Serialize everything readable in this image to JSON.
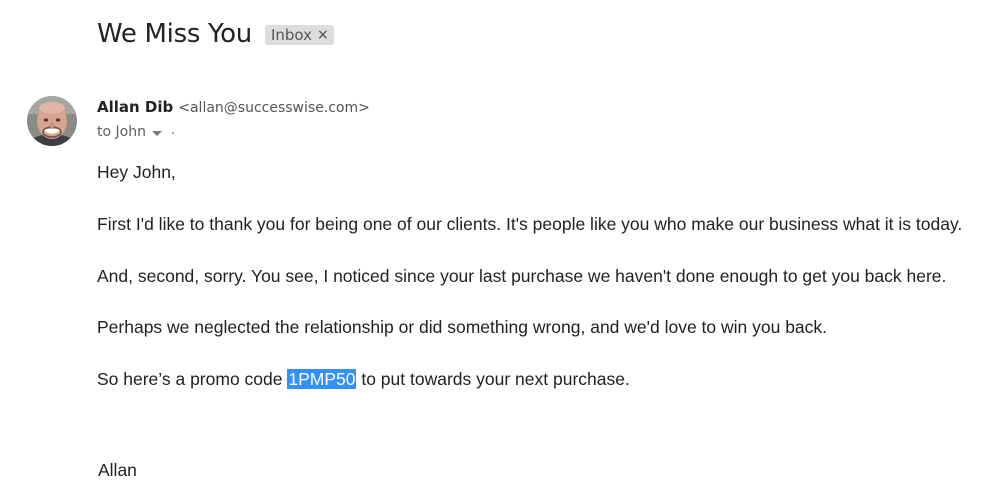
{
  "email": {
    "subject": "We Miss You",
    "label": "Inbox",
    "label_close": "×",
    "sender_name": "Allan Dib",
    "sender_email": "<allan@successwise.com>",
    "recipient": "to John",
    "greeting": "Hey John,",
    "paragraph_1": "First I'd like to thank you for being one of our clients. It's people like you who make our business what it is today.",
    "paragraph_2": "And, second, sorry. You see, I noticed since your last purchase we haven't done enough to get you back here.",
    "paragraph_3": "Perhaps we neglected the relationship or did something wrong, and we'd love to win you back.",
    "promo_prefix": "So here’s a promo code ",
    "promo_code": "1PMP50",
    "promo_suffix": " to put towards your next purchase.",
    "signature": "Allan"
  },
  "icons": {
    "avatar": "sender-avatar",
    "recipient_dropdown": "chevron-down-icon",
    "label_close": "close-icon"
  },
  "colors": {
    "selection_highlight": "#3390ff",
    "label_chip_bg": "#dddddd"
  }
}
